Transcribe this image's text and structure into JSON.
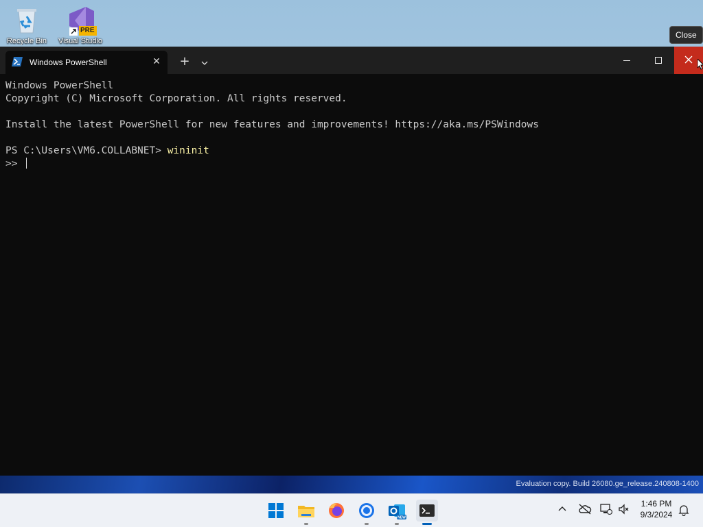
{
  "desktop": {
    "icons": [
      {
        "label": "Recycle Bin"
      },
      {
        "label": "Visual Studio",
        "badge": "PRE"
      }
    ]
  },
  "window": {
    "tab_title": "Windows PowerShell",
    "tooltip": "Close",
    "console_lines": [
      "Windows PowerShell",
      "Copyright (C) Microsoft Corporation. All rights reserved.",
      "",
      "Install the latest PowerShell for new features and improvements! https://aka.ms/PSWindows",
      ""
    ],
    "prompt": "PS C:\\Users\\VM6.COLLABNET> ",
    "command": "wininit",
    "continuation": ">> "
  },
  "watermark": "Evaluation copy. Build 26080.ge_release.240808-1400",
  "taskbar": {
    "apps": [
      "start-icon",
      "file-explorer-icon",
      "firefox-icon",
      "chrome-icon",
      "outlook-icon",
      "terminal-icon"
    ],
    "time": "1:46 PM",
    "date": "9/3/2024"
  },
  "colors": {
    "close_red": "#c42b1c",
    "console_bg": "#0c0c0c",
    "command_yellow": "#f9f1a5"
  }
}
